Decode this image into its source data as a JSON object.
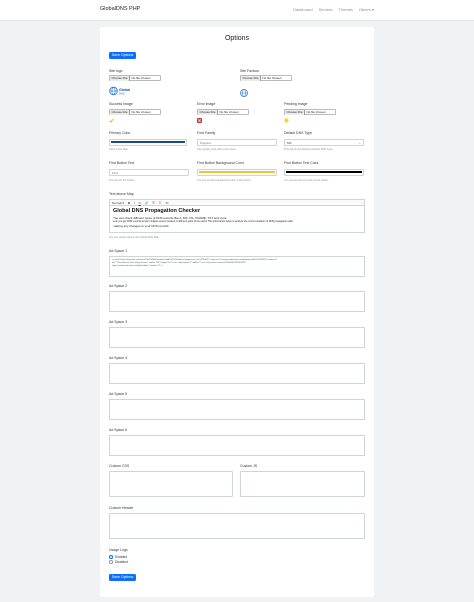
{
  "navbar": {
    "brand": "GlobalDNS PHP",
    "links": [
      "Dashboard",
      "Servers",
      "Themes",
      "Others ▾"
    ]
  },
  "page": {
    "title": "Options"
  },
  "buttons": {
    "save_top": "Save Options",
    "save_bottom": "Save Options"
  },
  "file_input": {
    "button": "Choose File",
    "status": "No file chosen"
  },
  "fields": {
    "site_logo": "Site logo",
    "site_favicon": "Site Favicon",
    "success_image": "Success image",
    "error_image": "Error image",
    "pending_image": "Pending image",
    "primary_color": "Primary Color",
    "primary_color_help": "Used in the Map.",
    "font_family": "Font Family",
    "font_family_value": "Poppins",
    "font_family_help": "Use google fonts with exact name.",
    "default_dns_type": "Default DNS Type",
    "default_dns_type_value": "MX",
    "default_dns_type_help": "This will be the default selected DNS Type.",
    "find_button_text": "Find Button Text",
    "find_button_text_value": "Find",
    "find_button_text_help": "The text for the button.",
    "find_button_bg": "Find Button Background Color",
    "find_button_bg_help": "You can set the background color of the button.",
    "find_button_text_color": "Find Button Text Color",
    "find_button_text_color_help": "You can set the text color of the button.",
    "text_above_map": "Text above Map",
    "text_above_map_help": "The text shown above the Global DNS Map.",
    "ad_space_1": "Ad Space 1",
    "ad_space_2": "Ad Space 2",
    "ad_space_3": "Ad Space 3",
    "ad_space_4": "Ad Space 4",
    "ad_space_5": "Ad Space 5",
    "ad_space_6": "Ad Space 6",
    "custom_css": "Custom CSS",
    "custom_js": "Custom JS",
    "custom_header": "Custom Header",
    "usage_logs": "Usage Logs",
    "usage_logs_enabled": "Enabled",
    "usage_logs_disabled": "Disabled"
  },
  "logo": {
    "text_top": "Global",
    "text_bottom": "DNS"
  },
  "editor": {
    "toolbar": [
      "Normal ▾",
      "B",
      "I",
      "U",
      "🔗",
      "☰",
      "☷",
      "Tx"
    ],
    "heading": "Global DNS Propagation Checker",
    "line1": "You can check different types of DNS records like A, MX, NS, CNAME, TXT and more.",
    "line2": "Lets you get DNS records across multiple servers located in different parts of the world. This information helps to analyze the current situation of DNS propagation after",
    "line3": "making any changes to your DNS records."
  },
  "ad_space_1_code": [
    "<a href=\"https://d.prosaic.markets/ct?id=32984&url=https%3A%2F%2Fwww.hostinger.com\" id=\"4235459\"><img src=\"//a.impactradius-go.com/display-ad/4423-4235459\" border=\"0\"",
    "alt=\"\"ThemeForest best-selling themes\" width=\"728\" height=\"90\"/></a><img height=\"0\" width=\"0\" src=\"//d.prosaic.markets/i/32984/4235459/4423\"",
    "style=\"position:absolute;visibility:hidden;\" border=\"0\" />"
  ],
  "colors": {
    "primary": "#16498a",
    "find_button_bg": "#f4c430",
    "find_button_text": "#000000",
    "accent": "#0d6efd",
    "success_icon": "#f1b417",
    "error_icon": "#c0392b",
    "pending_icon": "#f7d33a"
  }
}
